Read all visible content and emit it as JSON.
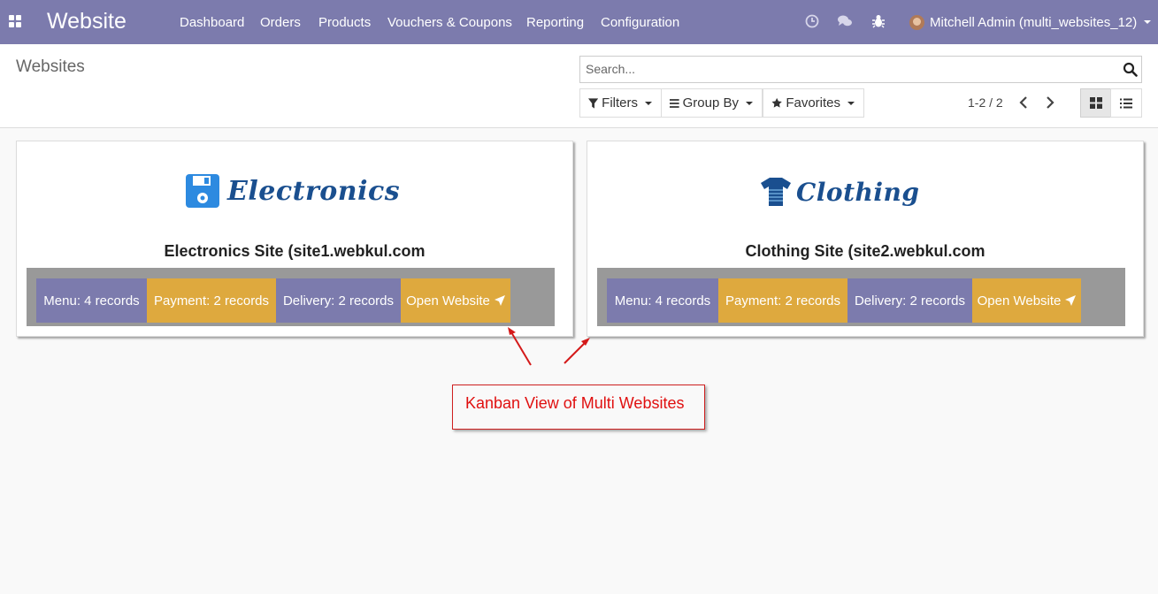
{
  "navbar": {
    "brand": "Website",
    "menu": [
      "Dashboard",
      "Orders",
      "Products",
      "Vouchers & Coupons",
      "Reporting",
      "Configuration"
    ],
    "icons": [
      "clock-icon",
      "chat-icon",
      "bug-icon"
    ],
    "user": "Mitchell Admin (multi_websites_12)",
    "color": "#7c7bad"
  },
  "control": {
    "title": "Websites",
    "search_placeholder": "Search...",
    "filters": "Filters",
    "group_by": "Group By",
    "favorites": "Favorites",
    "pager": "1-2 / 2",
    "views": [
      "kanban",
      "list"
    ],
    "active_view": "kanban"
  },
  "cards": [
    {
      "logo_text": "Electronics",
      "name": "Electronics Site (site1.webkul.com",
      "menu": "Menu: 4 records",
      "payment": "Payment: 2 records",
      "delivery": "Delivery: 2 records",
      "open": "Open Website"
    },
    {
      "logo_text": "Clothing",
      "name": "Clothing Site (site2.webkul.com",
      "menu": "Menu: 4 records",
      "payment": "Payment: 2 records",
      "delivery": "Delivery: 2 records",
      "open": "Open Website"
    }
  ],
  "annotation": "Kanban View of Multi Websites",
  "colors": {
    "purple": "#7c7bad",
    "orange": "#dea93e",
    "bar": "#999999",
    "annotation": "#e01010"
  }
}
